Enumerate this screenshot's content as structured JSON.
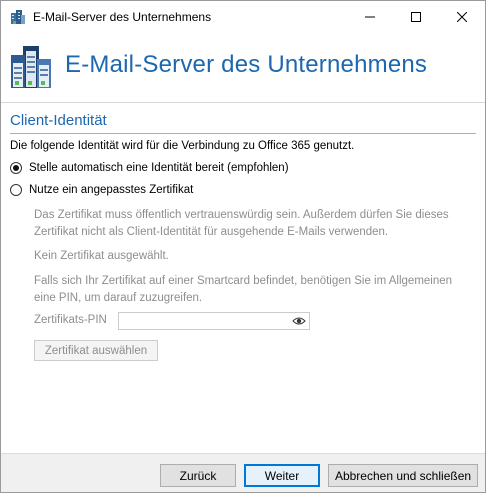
{
  "window": {
    "title": "E-Mail-Server des Unternehmens",
    "controls": {
      "minimize": "—",
      "maximize": "☐",
      "close": "✕"
    }
  },
  "header": {
    "heading": "E-Mail-Server des Unternehmens",
    "icon": "server-buildings-icon"
  },
  "section": {
    "title": "Client-Identität",
    "intro": "Die folgende Identität wird für die Verbindung zu Office 365 genutzt."
  },
  "options": {
    "auto_label": "Stelle automatisch eine Identität bereit (empfohlen)",
    "auto_selected": true,
    "custom_label": "Nutze ein angepasstes Zertifikat",
    "custom_selected": false
  },
  "certificate": {
    "description": "Das Zertifikat muss öffentlich vertrauenswürdig sein. Außerdem dürfen Sie dieses Zertifikat nicht als Client-Identität für ausgehende E-Mails verwenden.",
    "status": "Kein Zertifikat ausgewählt.",
    "smartcard_note": "Falls sich Ihr Zertifikat auf einer Smartcard befindet, benötigen Sie im Allgemeinen eine PIN, um darauf zuzugreifen.",
    "pin_label": "Zertifikats-PIN",
    "pin_value": "",
    "select_button": "Zertifikat auswählen"
  },
  "footer": {
    "back": "Zurück",
    "next": "Weiter",
    "cancel": "Abbrechen und schließen"
  },
  "colors": {
    "accent": "#1c67b0",
    "disabled_text": "#8e8e8e",
    "footer_bg": "#f0f0f0"
  }
}
